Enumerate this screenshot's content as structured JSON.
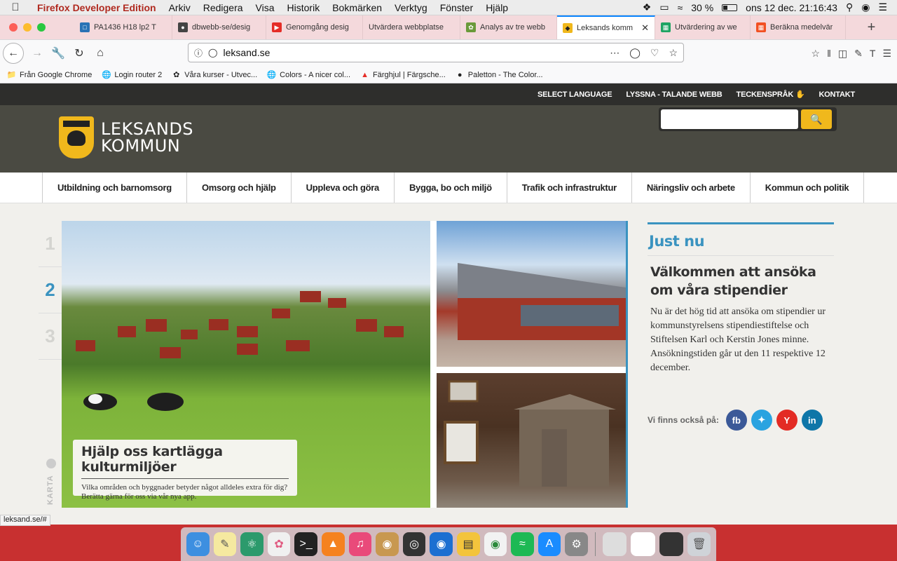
{
  "menubar": {
    "app": "Firefox Developer Edition",
    "items": [
      "Arkiv",
      "Redigera",
      "Visa",
      "Historik",
      "Bokmärken",
      "Verktyg",
      "Fönster",
      "Hjälp"
    ],
    "battery": "30 %",
    "battery_level": 0.3,
    "clock": "ons 12 dec.  21:16:43"
  },
  "tabs": [
    {
      "title": "PA1436 H18 lp2 T",
      "icon": "its-icon",
      "color": "#2a72b5"
    },
    {
      "title": "dbwebb-se/desig",
      "icon": "github-icon",
      "color": "#444444"
    },
    {
      "title": "Genomgång desig",
      "icon": "youtube-icon",
      "color": "#e52d27"
    },
    {
      "title": "Utvärdera webbplatse",
      "icon": "",
      "color": "#f4d9dc"
    },
    {
      "title": "Analys av tre webb",
      "icon": "leaf-icon",
      "color": "#6a9a3a"
    },
    {
      "title": "Leksands komm",
      "icon": "leksand-icon",
      "color": "#f0b81c"
    },
    {
      "title": "Utvärdering av we",
      "icon": "sheets-icon",
      "color": "#1fa463"
    },
    {
      "title": "Beräkna medelvär",
      "icon": "windows-icon",
      "color": "#f25022"
    }
  ],
  "url": "leksand.se",
  "bookmarks": [
    "Från Google Chrome",
    "Login router 2",
    "Våra kurser - Utvec...",
    "Colors - A nicer col...",
    "Färghjul | Färgsche...",
    "Paletton - The Color..."
  ],
  "site": {
    "top_links": [
      "SELECT LANGUAGE",
      "LYSSNA - TALANDE WEBB",
      "TECKENSPRÅK",
      "KONTAKT"
    ],
    "logo_line1": "LEKSANDS",
    "logo_line2": "KOMMUN",
    "search_placeholder": "",
    "nav": [
      "Utbildning och barnomsorg",
      "Omsorg och hjälp",
      "Uppleva och göra",
      "Bygga, bo och miljö",
      "Trafik och infrastruktur",
      "Näringsliv och arbete",
      "Kommun och politik"
    ],
    "slides": [
      "1",
      "2",
      "3"
    ],
    "karta": "KARTA",
    "caption_title": "Hjälp oss kartlägga kulturmiljöer",
    "caption_text": "Vilka områden och byggnader betyder något alldeles extra för dig? Berätta gärna för oss via vår nya app.",
    "justnu_title": "Just nu",
    "news_title": "Välkommen att ansöka om våra stipendier",
    "news_text": "Nu är det hög tid att ansöka om stipendier ur kommunstyrelsens stipendiestiftelse och Stiftelsen Karl och Kerstin Jones minne. Ansökningstiden går ut den 11 respektive 12 december.",
    "social_label": "Vi finns också på:",
    "social": [
      {
        "label": "fb",
        "color": "#3b5998"
      },
      {
        "label": "t",
        "color": "#2aa3e0"
      },
      {
        "label": "Y",
        "color": "#e32b24"
      },
      {
        "label": "in",
        "color": "#0e76a8"
      }
    ]
  },
  "status_url": "leksand.se/#"
}
